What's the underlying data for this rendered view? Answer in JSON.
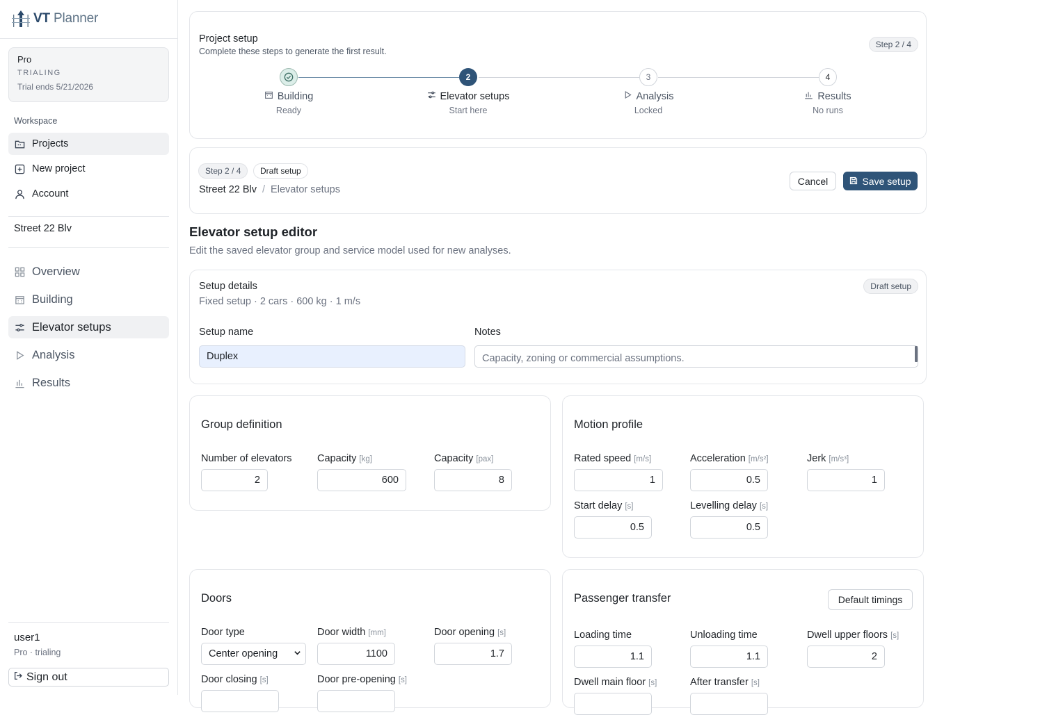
{
  "brand": {
    "name_bold": "VT",
    "name_light": "Planner"
  },
  "plan": {
    "name": "Pro",
    "status": "TRIALING",
    "trial": "Trial ends 5/21/2026"
  },
  "workspace": {
    "label": "Workspace",
    "items": [
      {
        "label": "Projects",
        "icon": "folder-icon"
      },
      {
        "label": "New project",
        "icon": "plus-square-icon"
      },
      {
        "label": "Account",
        "icon": "user-icon"
      }
    ]
  },
  "project": {
    "name": "Street 22 Blv",
    "nav": [
      {
        "label": "Overview",
        "icon": "grid-icon"
      },
      {
        "label": "Building",
        "icon": "building-icon"
      },
      {
        "label": "Elevator setups",
        "icon": "sliders-icon"
      },
      {
        "label": "Analysis",
        "icon": "play-icon"
      },
      {
        "label": "Results",
        "icon": "bar-chart-icon"
      }
    ]
  },
  "user": {
    "name": "user1",
    "sub": "Pro · trialing",
    "signout": "Sign out"
  },
  "setup_card": {
    "title": "Project setup",
    "subtitle": "Complete these steps to generate the first result.",
    "badge": "Step 2 / 4",
    "steps": [
      {
        "num": "",
        "label": "Building",
        "sub": "Ready"
      },
      {
        "num": "2",
        "label": "Elevator setups",
        "sub": "Start here"
      },
      {
        "num": "3",
        "label": "Analysis",
        "sub": "Locked"
      },
      {
        "num": "4",
        "label": "Results",
        "sub": "No runs"
      }
    ]
  },
  "header_card": {
    "badge_step": "Step 2 / 4",
    "badge_draft": "Draft setup",
    "crumb_project": "Street 22 Blv",
    "crumb_sep": "/",
    "crumb_page": "Elevator setups",
    "cancel": "Cancel",
    "save": "Save setup"
  },
  "editor": {
    "title": "Elevator setup editor",
    "subtitle": "Edit the saved elevator group and service model used for new analyses."
  },
  "details": {
    "title": "Setup details",
    "summary": "Fixed setup · 2 cars · 600 kg · 1 m/s",
    "badge": "Draft setup",
    "name_label": "Setup name",
    "name_value": "Duplex",
    "notes_label": "Notes",
    "notes_placeholder": "Capacity, zoning or commercial assumptions."
  },
  "group": {
    "title": "Group definition",
    "fields": [
      {
        "label": "Number of elevators",
        "unit": "",
        "value": "2"
      },
      {
        "label": "Capacity",
        "unit": "[kg]",
        "value": "600"
      },
      {
        "label": "Capacity",
        "unit": "[pax]",
        "value": "8"
      }
    ]
  },
  "motion": {
    "title": "Motion profile",
    "fields": [
      {
        "label": "Rated speed",
        "unit": "[m/s]",
        "value": "1"
      },
      {
        "label": "Acceleration",
        "unit": "[m/s²]",
        "value": "0.5"
      },
      {
        "label": "Jerk",
        "unit": "[m/s³]",
        "value": "1"
      },
      {
        "label": "Start delay",
        "unit": "[s]",
        "value": "0.5"
      },
      {
        "label": "Levelling delay",
        "unit": "[s]",
        "value": "0.5"
      }
    ]
  },
  "doors": {
    "title": "Doors",
    "fields": [
      {
        "label": "Door type",
        "unit": "",
        "value": "Center opening"
      },
      {
        "label": "Door width",
        "unit": "[mm]",
        "value": "1100"
      },
      {
        "label": "Door opening",
        "unit": "[s]",
        "value": "1.7"
      },
      {
        "label": "Door closing",
        "unit": "[s]",
        "value": ""
      },
      {
        "label": "Door pre-opening",
        "unit": "[s]",
        "value": ""
      }
    ]
  },
  "transfer": {
    "title": "Passenger transfer",
    "button": "Default timings",
    "fields": [
      {
        "label": "Loading time",
        "unit": "",
        "value": "1.1"
      },
      {
        "label": "Unloading time",
        "unit": "",
        "value": "1.1"
      },
      {
        "label": "Dwell upper floors",
        "unit": "[s]",
        "value": "2"
      },
      {
        "label": "Dwell main floor",
        "unit": "[s]",
        "value": ""
      },
      {
        "label": "After transfer",
        "unit": "[s]",
        "value": ""
      }
    ]
  },
  "colors": {
    "primary": "#2f5478",
    "step_done": "#dceee9",
    "active_nav": "#f0f1f3",
    "input_highlight": "#e8f0fe"
  }
}
